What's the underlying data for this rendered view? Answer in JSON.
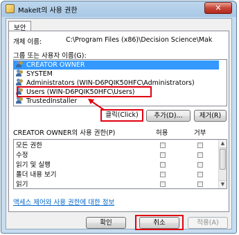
{
  "window": {
    "title": "MakeIt의 사용 권한",
    "close_glyph": "✕"
  },
  "tab": {
    "label": "보안"
  },
  "object": {
    "label": "개체 이름:",
    "value": "C:\\Program Files (x86)\\Decision Science\\Mak"
  },
  "groups": {
    "label": "그룹 또는 사용자 이름(G):",
    "items": [
      {
        "label": "CREATOR OWNER",
        "selected": true
      },
      {
        "label": "SYSTEM",
        "selected": false
      },
      {
        "label": "Administrators (WIN-D6PQIK50HFC\\Administrators)",
        "selected": false
      },
      {
        "label": "Users (WIN-D6PQIK50HFC\\Users)",
        "selected": false
      },
      {
        "label": "TrustedInstaller",
        "selected": false
      }
    ]
  },
  "annotation": {
    "click_label": "클릭(Click)"
  },
  "buttons": {
    "add": "추가(D)...",
    "remove": "제거(R)",
    "ok": "확인",
    "cancel": "취소",
    "apply": "적용(A)"
  },
  "permissions": {
    "label": "CREATOR OWNER의 사용 권한(P)",
    "allow_header": "허용",
    "deny_header": "거부",
    "rows": [
      {
        "name": "모든 권한",
        "allow": false,
        "deny": false
      },
      {
        "name": "수정",
        "allow": false,
        "deny": false
      },
      {
        "name": "읽기 및 실행",
        "allow": false,
        "deny": false
      },
      {
        "name": "폴더 내용 보기",
        "allow": false,
        "deny": false
      },
      {
        "name": "읽기",
        "allow": false,
        "deny": false
      }
    ]
  },
  "link": {
    "label": "액세스 제어와 사용 권한에 대한 정보"
  },
  "colors": {
    "highlight": "#e0000f",
    "selection": "#3399ff",
    "link": "#0066cc"
  }
}
